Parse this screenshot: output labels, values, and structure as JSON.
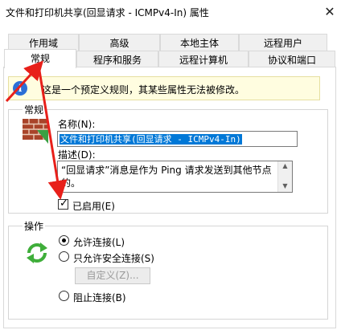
{
  "window": {
    "title": "文件和打印机共享(回显请求 - ICMPv4-In) 属性",
    "close_symbol": "✕"
  },
  "tabs_row1": [
    "作用域",
    "高级",
    "本地主体",
    "远程用户"
  ],
  "tabs_row2": [
    "常规",
    "程序和服务",
    "远程计算机",
    "协议和端口"
  ],
  "selected_tab": "常规",
  "info": {
    "icon": "info-icon",
    "text": "这是一个预定义规则，其某些属性无法被修改。"
  },
  "general": {
    "legend": "常规",
    "name_label": "名称(N):",
    "name_value": "文件和打印机共享(回显请求 - ICMPv4-In)",
    "desc_label": "描述(D):",
    "desc_value": "“回显请求”消息是作为 Ping 请求发送到其他节点的。",
    "enabled_label": "已启用(E)",
    "enabled_checked": true
  },
  "action": {
    "legend": "操作",
    "allow_label": "允许连接(L)",
    "allow_secure_label": "只允许安全连接(S)",
    "custom_label": "自定义(Z)...",
    "block_label": "阻止连接(B)",
    "selected": "allow"
  },
  "colors": {
    "selection_blue": "#0078d7",
    "info_bg": "#fffde0",
    "annotation_red": "#e8201a"
  }
}
